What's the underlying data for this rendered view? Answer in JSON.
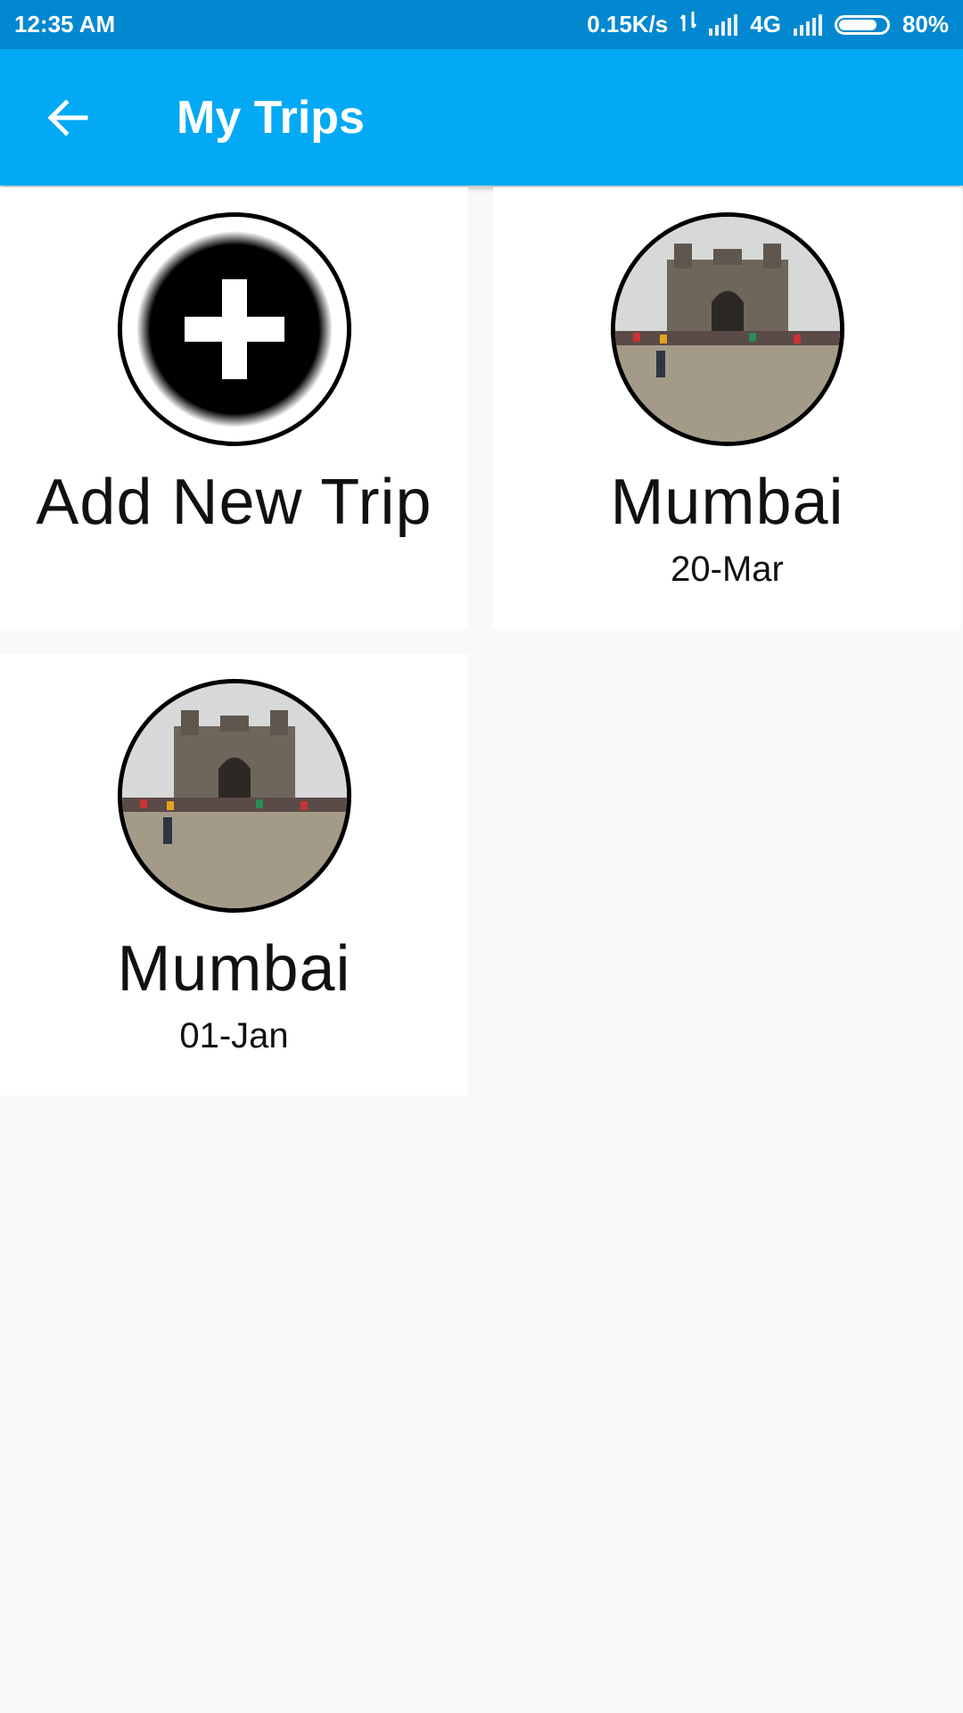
{
  "status_bar": {
    "time": "12:35 AM",
    "network_speed": "0.15K/s",
    "network_type": "4G",
    "battery_percent": "80%",
    "battery_level": 0.8
  },
  "app_bar": {
    "title": "My Trips",
    "back_icon": "arrow-left-icon",
    "background": "#03a9f4"
  },
  "add_card": {
    "label": "Add New Trip",
    "icon": "plus-icon"
  },
  "trips": [
    {
      "name": "Mumbai",
      "date": "20-Mar",
      "photo": "gateway-of-india-photo"
    },
    {
      "name": "Mumbai",
      "date": "01-Jan",
      "photo": "gateway-of-india-photo"
    }
  ]
}
